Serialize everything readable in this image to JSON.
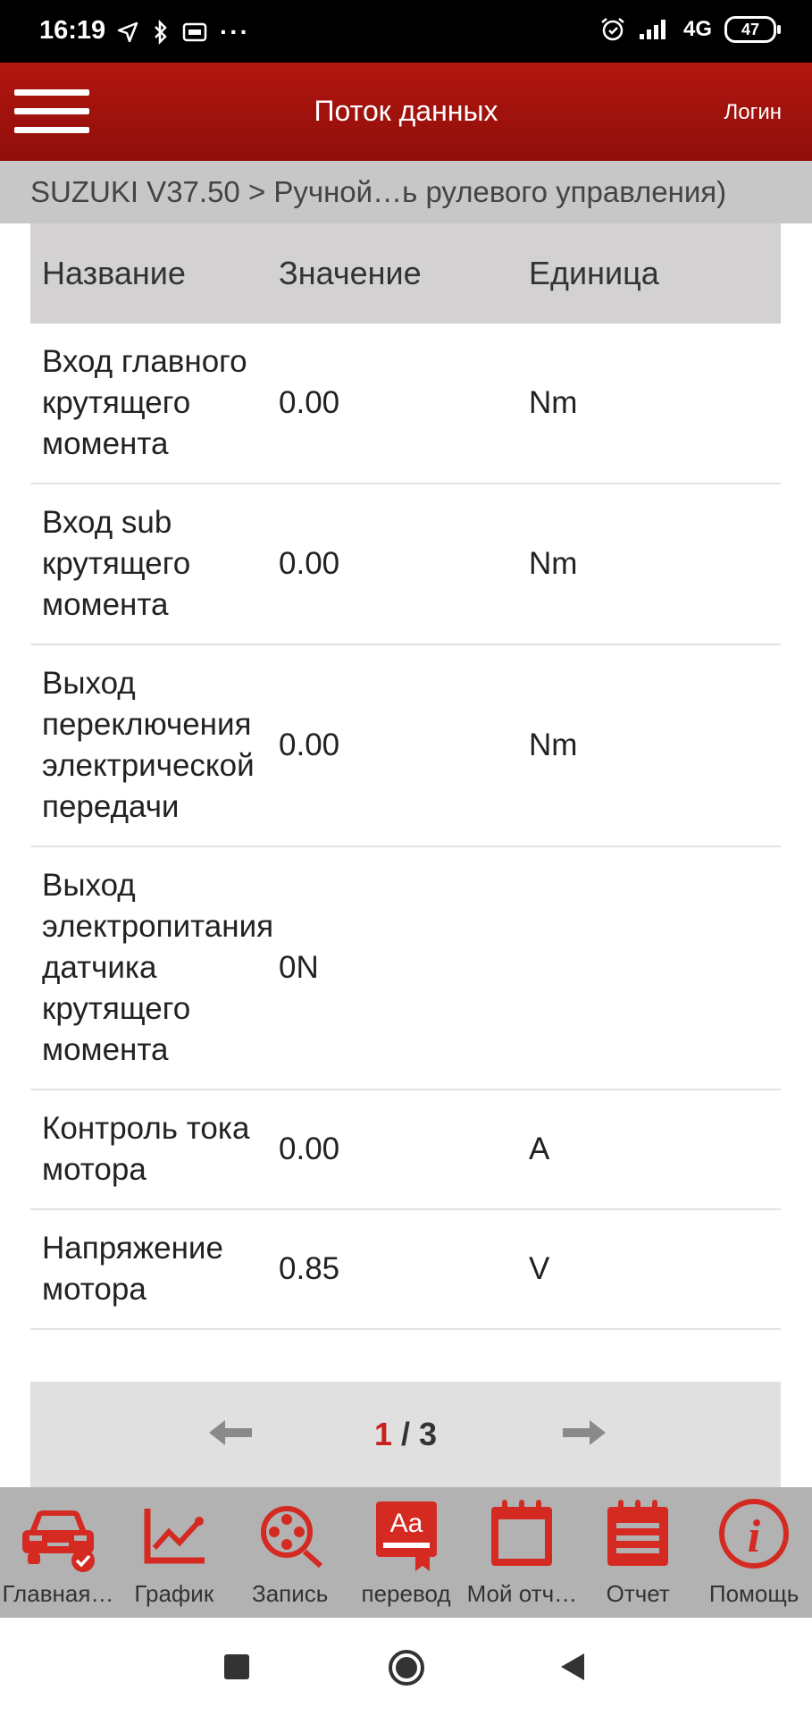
{
  "status": {
    "time": "16:19",
    "network": "4G",
    "battery": "47"
  },
  "header": {
    "title": "Поток данных",
    "login": "Логин"
  },
  "breadcrumb": "SUZUKI V37.50 > Ручной…ь рулевого управления)",
  "table": {
    "headers": {
      "name": "Название",
      "value": "Значение",
      "unit": "Единица"
    },
    "rows": [
      {
        "name": "Вход главного крутящего момента",
        "value": "0.00",
        "unit": "Nm"
      },
      {
        "name": "Вход sub крутящего момента",
        "value": "0.00",
        "unit": "Nm"
      },
      {
        "name": "Выход переключения электрической передачи",
        "value": "0.00",
        "unit": "Nm"
      },
      {
        "name": "Выход электропитания датчика крутящего момента",
        "value": "0N",
        "unit": ""
      },
      {
        "name": "Контроль тока мотора",
        "value": "0.00",
        "unit": "A"
      },
      {
        "name": "Напряжение мотора",
        "value": "0.85",
        "unit": "V"
      }
    ]
  },
  "pager": {
    "current": "1",
    "separator": " / ",
    "total": "3"
  },
  "toolbar": [
    {
      "label": "Главная…",
      "icon": "car-icon"
    },
    {
      "label": "График",
      "icon": "graph-icon"
    },
    {
      "label": "Запись",
      "icon": "record-icon"
    },
    {
      "label": "перевод",
      "icon": "translate-icon"
    },
    {
      "label": "Мой отч…",
      "icon": "my-report-icon"
    },
    {
      "label": "Отчет",
      "icon": "report-icon"
    },
    {
      "label": "Помощь",
      "icon": "help-icon"
    }
  ],
  "colors": {
    "brand_red": "#c8201a",
    "header_red": "#a3120d"
  }
}
